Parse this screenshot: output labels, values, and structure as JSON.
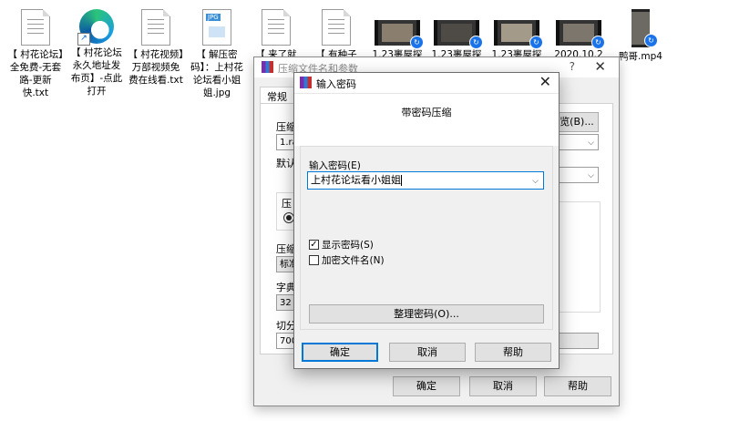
{
  "desktop": {
    "icons": [
      {
        "label": "【 村花论坛】全免费-无套路-更新快.txt"
      },
      {
        "label": "【 村花论坛永久地址发布页】-点此打开"
      },
      {
        "label": "【 村花视频】万部视频免费在线看.txt"
      },
      {
        "label": "【 解压密码】：上村花论坛看小姐姐.jpg"
      },
      {
        "label": "【 来了就"
      },
      {
        "label": "【 有种子"
      },
      {
        "label": "1.23裹屋探"
      },
      {
        "label": "1.23裹屋探"
      },
      {
        "label": "1.23裹屋探"
      },
      {
        "label": "2020.10.2"
      },
      {
        "label": "鸭哥.mp4"
      }
    ],
    "icon_types": [
      "txt",
      "edge-link",
      "txt",
      "jpg",
      "txt",
      "txt",
      "video",
      "video",
      "video",
      "video",
      "video"
    ]
  },
  "back_dialog": {
    "title": "压缩文件名和参数",
    "help_q": "?",
    "tab_general": "常规",
    "label_archive": "压缩",
    "archive_value": "1.ra",
    "browse_button": "览(B)...",
    "label_default": "默认",
    "group_format": "压",
    "label_method": "压缩",
    "method_value": "标准",
    "label_dict": "字典",
    "dict_value": "32 M",
    "label_split": "切分",
    "split_value": "700",
    "ok": "确定",
    "cancel": "取消",
    "help": "帮助"
  },
  "front_dialog": {
    "title": "输入密码",
    "header": "带密码压缩",
    "password_label": "输入密码(E)",
    "password_value": "上村花论坛看小姐姐",
    "show_password": {
      "label": "显示密码(S)",
      "checked": true
    },
    "encrypt_names": {
      "label": "加密文件名(N)",
      "checked": false
    },
    "organize_button": "整理密码(O)...",
    "ok": "确定",
    "cancel": "取消",
    "help": "帮助"
  },
  "colors": {
    "accent": "#0078d7",
    "dialog_bg": "#f0f0f0",
    "button_bg": "#e1e1e1"
  }
}
